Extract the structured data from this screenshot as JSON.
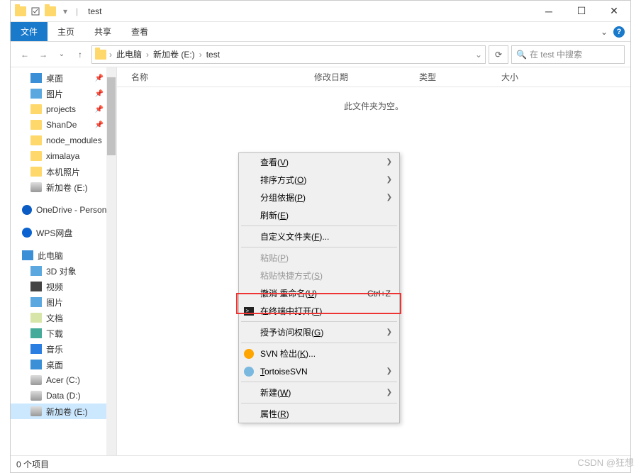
{
  "title": "test",
  "ribbon": {
    "file": "文件",
    "home": "主页",
    "share": "共享",
    "view": "查看"
  },
  "breadcrumbs": [
    "此电脑",
    "新加卷 (E:)",
    "test"
  ],
  "search_placeholder": "在 test 中搜索",
  "columns": {
    "name": "名称",
    "date": "修改日期",
    "type": "类型",
    "size": "大小"
  },
  "empty": "此文件夹为空。",
  "status": "0 个项目",
  "sidebar": {
    "quick": [
      {
        "label": "桌面",
        "icon": "desktop",
        "pin": true
      },
      {
        "label": "图片",
        "icon": "pic",
        "pin": true
      },
      {
        "label": "projects",
        "icon": "folder",
        "pin": true
      },
      {
        "label": "ShanDe",
        "icon": "folder",
        "pin": true
      },
      {
        "label": "node_modules",
        "icon": "folder"
      },
      {
        "label": "ximalaya",
        "icon": "folder"
      },
      {
        "label": "本机照片",
        "icon": "folder"
      },
      {
        "label": "新加卷 (E:)",
        "icon": "drive"
      }
    ],
    "onedrive": "OneDrive - Personal",
    "wps": "WPS网盘",
    "thispc": "此电脑",
    "pc_items": [
      {
        "label": "3D 对象",
        "icon": "pic"
      },
      {
        "label": "视频",
        "icon": "video"
      },
      {
        "label": "图片",
        "icon": "pic"
      },
      {
        "label": "文档",
        "icon": "doc"
      },
      {
        "label": "下载",
        "icon": "download"
      },
      {
        "label": "音乐",
        "icon": "music"
      },
      {
        "label": "桌面",
        "icon": "desktop"
      },
      {
        "label": "Acer (C:)",
        "icon": "drive"
      },
      {
        "label": "Data (D:)",
        "icon": "drive"
      },
      {
        "label": "新加卷 (E:)",
        "icon": "drive",
        "selected": true
      }
    ]
  },
  "menu": {
    "view": "查看(V)",
    "sort": "排序方式(O)",
    "group": "分组依据(P)",
    "refresh": "刷新(E)",
    "customize": "自定义文件夹(F)...",
    "paste": "粘贴(P)",
    "paste_shortcut": "粘贴快捷方式(S)",
    "undo": "撤消 重命名(U)",
    "undo_key": "Ctrl+Z",
    "terminal": "在终端中打开(T)",
    "access": "授予访问权限(G)",
    "svn_checkout": "SVN 检出(K)...",
    "tortoise": "TortoiseSVN",
    "new": "新建(W)",
    "properties": "属性(R)"
  },
  "watermark": "CSDN @狂想"
}
